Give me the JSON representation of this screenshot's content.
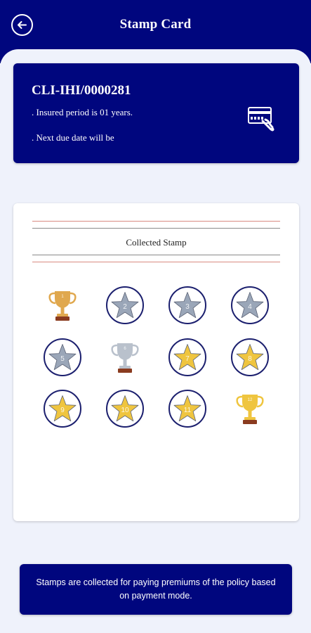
{
  "header": {
    "title": "Stamp Card",
    "back_icon": "back-arrow-icon"
  },
  "policy": {
    "number": "CLI-IHI/0000281",
    "line1": ". Insured period is 01 years.",
    "line2": ". Next due date will be",
    "icon": "card-hand-icon"
  },
  "stamps": {
    "title": "Collected Stamp",
    "items": [
      {
        "label": "1",
        "type": "trophy",
        "state": "bronze"
      },
      {
        "label": "2",
        "type": "star",
        "state": "pending"
      },
      {
        "label": "3",
        "type": "star",
        "state": "pending"
      },
      {
        "label": "4",
        "type": "star",
        "state": "pending"
      },
      {
        "label": "5",
        "type": "star",
        "state": "pending"
      },
      {
        "label": "6",
        "type": "trophy",
        "state": "silver"
      },
      {
        "label": "7",
        "type": "star",
        "state": "collected"
      },
      {
        "label": "8",
        "type": "star",
        "state": "collected"
      },
      {
        "label": "9",
        "type": "star",
        "state": "collected"
      },
      {
        "label": "10",
        "type": "star",
        "state": "collected"
      },
      {
        "label": "11",
        "type": "star",
        "state": "collected"
      },
      {
        "label": "12",
        "type": "trophy",
        "state": "gold"
      }
    ]
  },
  "footer": {
    "note": "Stamps are collected for paying premiums of the policy based on payment mode."
  },
  "colors": {
    "primary": "#00067e",
    "background": "#eff2fb",
    "star_collected": "#efc53f",
    "star_pending": "#9aa6b8",
    "stamp_ring": "#1b1f6e",
    "trophy_gold": "#efc53f",
    "trophy_silver": "#b9c1cc",
    "trophy_bronze": "#e0a84e"
  }
}
